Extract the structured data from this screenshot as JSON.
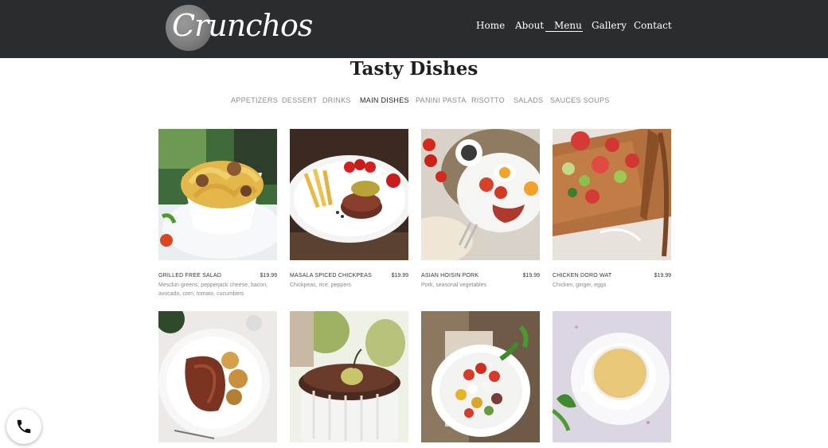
{
  "brand": {
    "logo_text": "Crunchos"
  },
  "nav": {
    "items": [
      "Home",
      "About",
      "Menu",
      "Gallery",
      "Contact"
    ],
    "active": "Menu"
  },
  "page": {
    "title": "Tasty Dishes"
  },
  "categories": {
    "items": [
      "APPETIZERS",
      "DESSERT",
      "DRINKS",
      "MAIN DISHES",
      "PANINI PASTA",
      "RISOTTO",
      "SALADS",
      "SAUCES SOUPS"
    ],
    "active": "MAIN DISHES"
  },
  "dishes": [
    {
      "name": "GRILLED FREE SALAD",
      "price": "$19.99",
      "description": "Mesclun greens, pepperjack cheese, bacon, avocado, corn, tomato, cucumbers"
    },
    {
      "name": "MASALA SPICED CHICKPEAS",
      "price": "$19.99",
      "description": "Chickpeas, rice, peppers"
    },
    {
      "name": "ASIAN HOISIN PORK",
      "price": "$19.99",
      "description": "Pork, seasonal vegetables"
    },
    {
      "name": "CHICKEN DORO WAT",
      "price": "$19.99",
      "description": "Chicken, ginger, eggs"
    }
  ],
  "icons": {
    "phone": "phone-icon"
  },
  "colors": {
    "header_bg": "#2a2d30",
    "nav_text": "#ffffff",
    "category_inactive": "#8a8a8a",
    "category_active": "#222222"
  }
}
